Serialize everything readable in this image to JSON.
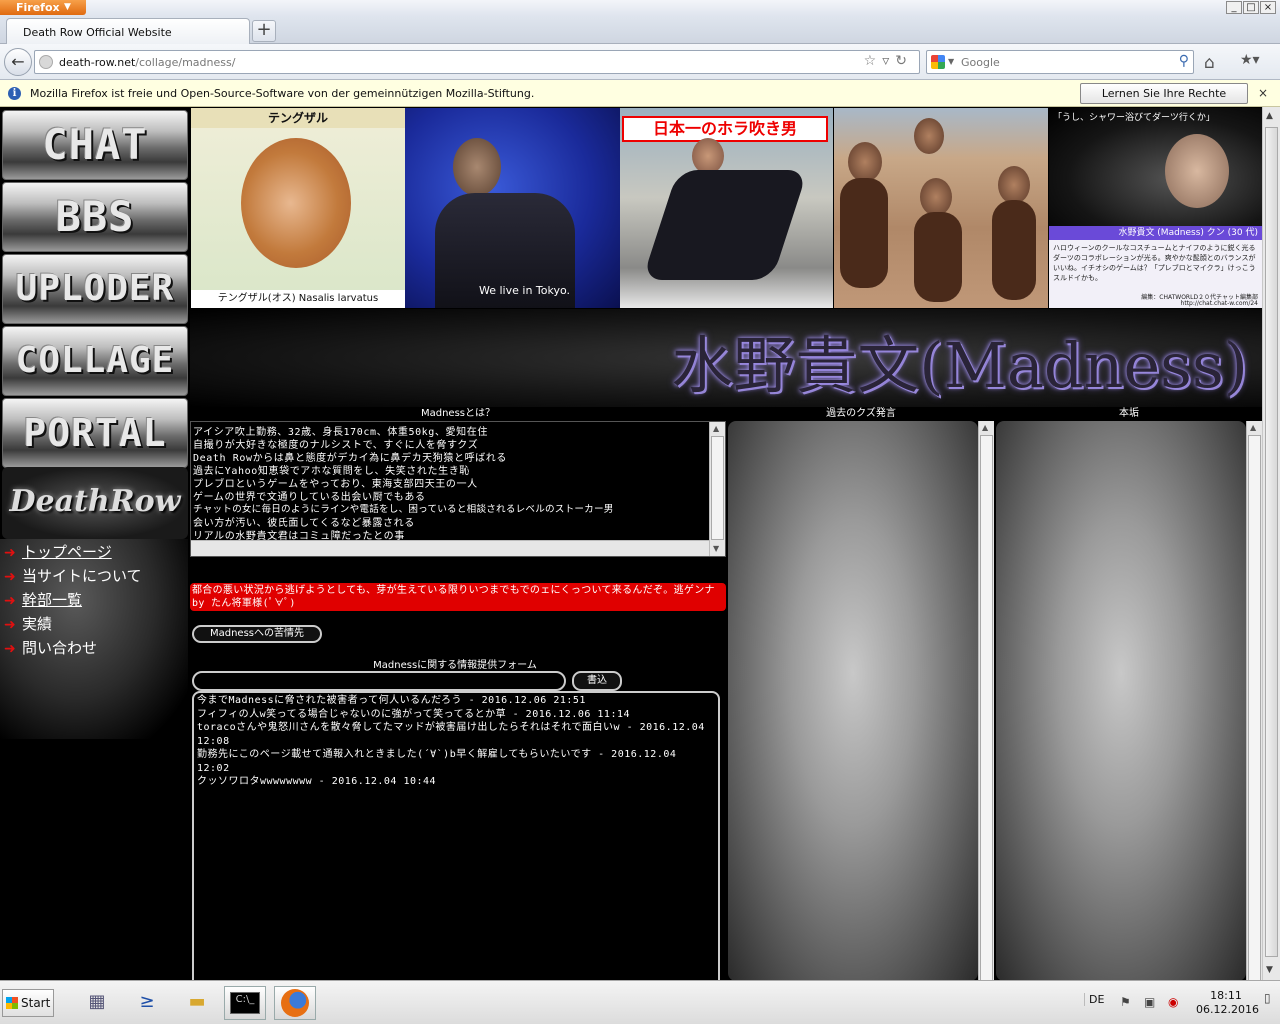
{
  "browser": {
    "app_button": "Firefox",
    "tab_title": "Death Row Official Website",
    "new_tab": "+",
    "url_host": "death-row.net",
    "url_path": "/collage/madness/",
    "search_placeholder": "Google",
    "notification": "Mozilla Firefox ist freie und Open-Source-Software von der gemeinnützigen Mozilla-Stiftung.",
    "notification_button": "Lernen Sie Ihre Rechte kennen...",
    "notification_close": "×"
  },
  "sidebar": {
    "nav_buttons": [
      "CHAT",
      "BBS",
      "UPLODER",
      "COLLAGE",
      "PORTAL"
    ],
    "logo": "DeathRow",
    "links": [
      "トップページ",
      "当サイトについて",
      "幹部一覧",
      "実績",
      "問い合わせ"
    ]
  },
  "photos": {
    "p1_caption_top": "テングザル",
    "p1_caption_bottom": "テングザル(オス) Nasalis larvatus",
    "p2_overlay": "We live in Tokyo.",
    "p3_title": "日本一のホラ吹き男",
    "p5_quote": "「うし、シャワー浴びてダーツ行くか」",
    "p5_name": "水野貴文 (Madness) クン (30 代)",
    "p5_desc": "ハロウィーンのクールなコスチュームとナイフのように鋭く光るダーツのコラボレーションが光る。爽やかな髭顔とのバランスがいいね。イチオシのゲームは？「プレブロとマイクラ」けっこうスルドイかも。",
    "p5_credit": "編集：CHATWORLD２０代チャット編集部",
    "p5_url": "http://chat.chat-w.com/24"
  },
  "banner": {
    "title": "水野貴文(Madness)"
  },
  "about": {
    "heading": "Madnessとは？",
    "lines": [
      "アイシア吹上勤務、32歳、身長170cm、体重50kg、愛知在住",
      "自撮りが大好きな極度のナルシストで、すぐに人を脅すクズ",
      "Death Rowからは鼻と態度がデカイ為に鼻デカ天狗猿と呼ばれる",
      "過去にYahoo知恵袋でアホな質問をし、失笑された生き恥",
      "プレブロというゲームをやっており、東海支部四天王の一人",
      "ゲームの世界で文通りしている出会い厨でもある",
      "チャットの女に毎日のようにラインや電話をし、困っていると相談されるレベルのストーカー男",
      "会い方が汚い、彼氏面してくるなど暴露される",
      "リアルの水野貴文君はコミュ障だったとの事"
    ]
  },
  "red_message": "都合の悪い状況から逃げようとしても、芽が生えている限りいつまでもでのェにくっついて来るんだぞ。逃ゲンナ by たん将軍様(ﾟ∀ﾟ)",
  "contact_button": "Madnessへの苦情先",
  "form": {
    "heading": "Madnessに関する情報提供フォーム",
    "submit": "書込",
    "comments": [
      "今までMadnessに脅された被害者って何人いるんだろう - 2016.12.06 21:51",
      "フィフィの人w笑ってる場合じゃないのに強がって笑ってるとか草 - 2016.12.06 11:14",
      "toracoさんや鬼怒川さんを散々脅してたマッドが被害届け出したらそれはそれで面白いw - 2016.12.04 12:08",
      "勤務先にこのページ載せて通報入れときました(´∀`)b早く解雇してもらいたいです - 2016.12.04 12:02",
      "クッソワロタwwwwwwww - 2016.12.04 10:44"
    ]
  },
  "panels": {
    "past_heading": "過去のクズ発言",
    "real_heading": "本垢"
  },
  "taskbar": {
    "start": "Start",
    "lang": "DE",
    "time": "18:11",
    "date": "06.12.2016"
  },
  "icons": [
    "firefox-icon",
    "back-arrow-icon",
    "globe-icon",
    "star-icon",
    "reload-icon",
    "google-icon",
    "magnifier-icon",
    "home-icon",
    "bookmarks-icon",
    "info-icon",
    "close-icon",
    "red-arrow-icon",
    "windows-flag-icon",
    "server-manager-icon",
    "powershell-icon",
    "explorer-folder-icon",
    "cmd-icon",
    "action-center-icon",
    "network-icon",
    "volume-icon"
  ],
  "colors": {
    "page_bg": "#000000",
    "alert_red": "#e00000",
    "firefox_orange": "#e76f12",
    "notification_bg": "#ffffe1"
  }
}
